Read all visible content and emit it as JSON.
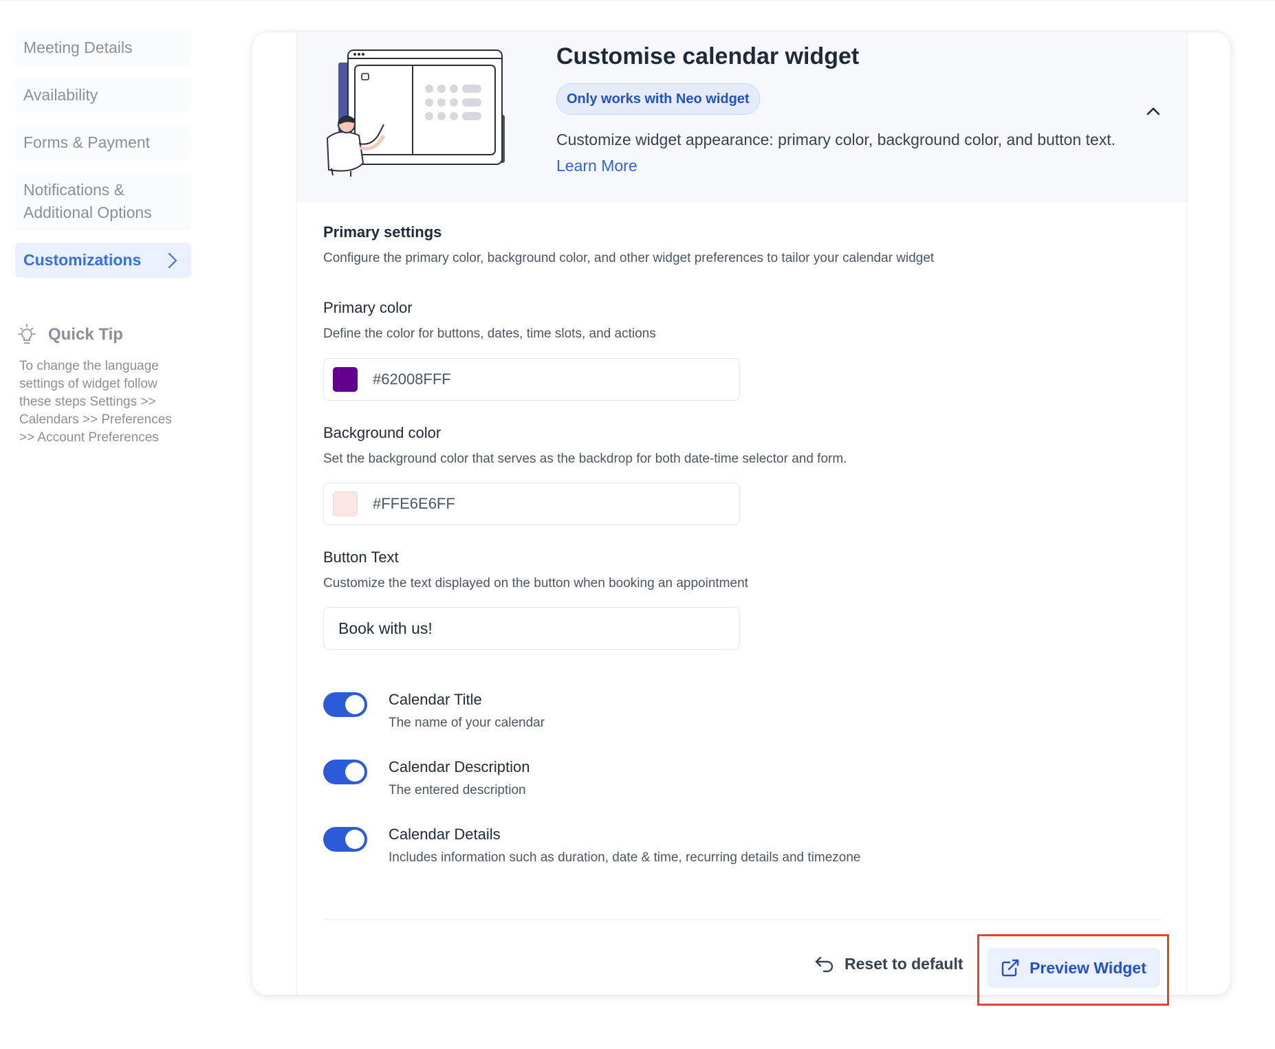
{
  "sidebar": {
    "items": [
      {
        "label": "Meeting Details"
      },
      {
        "label": "Availability"
      },
      {
        "label": "Forms & Payment"
      },
      {
        "label": "Notifications & Additional Options"
      },
      {
        "label": "Customizations"
      }
    ],
    "quick_tip": {
      "title": "Quick Tip",
      "text": "To change the language settings of widget follow these steps Settings >> Calendars >> Preferences >> Account Preferences"
    }
  },
  "hero": {
    "title": "Customise calendar widget",
    "badge": "Only works with Neo widget",
    "description": "Customize widget appearance: primary color, background color, and button text.",
    "learn_more": "Learn More"
  },
  "primary_settings": {
    "title": "Primary settings",
    "subtitle": "Configure the primary color, background color, and other widget preferences to tailor your calendar widget"
  },
  "primary_color": {
    "label": "Primary color",
    "subtitle": "Define the color for buttons, dates, time slots, and actions",
    "value": "#62008FFF",
    "swatch": "#62008F"
  },
  "background_color": {
    "label": "Background color",
    "subtitle": "Set the background color that serves as the backdrop for both date-time selector and form.",
    "value": "#FFE6E6FF",
    "swatch": "#FFE6E6"
  },
  "button_text": {
    "label": "Button Text",
    "subtitle": "Customize the text displayed on the button when booking an appointment",
    "value": "Book with us!"
  },
  "toggles": [
    {
      "title": "Calendar Title",
      "subtitle": "The name of your calendar",
      "on": true
    },
    {
      "title": "Calendar Description",
      "subtitle": "The entered description",
      "on": true
    },
    {
      "title": "Calendar Details",
      "subtitle": "Includes information such as duration, date & time, recurring details and timezone",
      "on": true
    }
  ],
  "footer": {
    "reset_label": "Reset to default",
    "preview_label": "Preview Widget"
  },
  "colors": {
    "accent": "#2c5ad8",
    "highlight": "#e8432a"
  }
}
